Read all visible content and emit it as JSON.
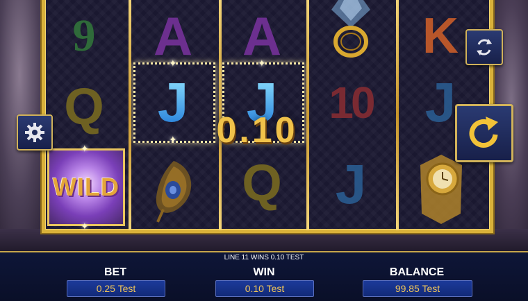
{
  "reels": {
    "col1": [
      "9",
      "Q",
      "WILD"
    ],
    "col2": [
      "A",
      "J",
      ""
    ],
    "col3": [
      "A",
      "J",
      "Q"
    ],
    "col4": [
      "",
      "10",
      "J"
    ],
    "col5": [
      "K",
      "J",
      ""
    ]
  },
  "win_amount": "0.10",
  "status_message": "LINE 11 WINS 0.10 TEST",
  "bet": {
    "label": "BET",
    "value": "0.25 Test"
  },
  "win": {
    "label": "WIN",
    "value": "0.10 Test"
  },
  "balance": {
    "label": "BALANCE",
    "value": "99.85 Test"
  },
  "icons": {
    "settings": "gear-icon",
    "autoplay": "refresh-arrows-icon",
    "spin": "spin-arrow-icon"
  },
  "colors": {
    "frame_gold": "#d9b13a",
    "panel_blue": "#0e1638",
    "value_text": "#f2c65a",
    "button_blue": "#2a3a72"
  }
}
